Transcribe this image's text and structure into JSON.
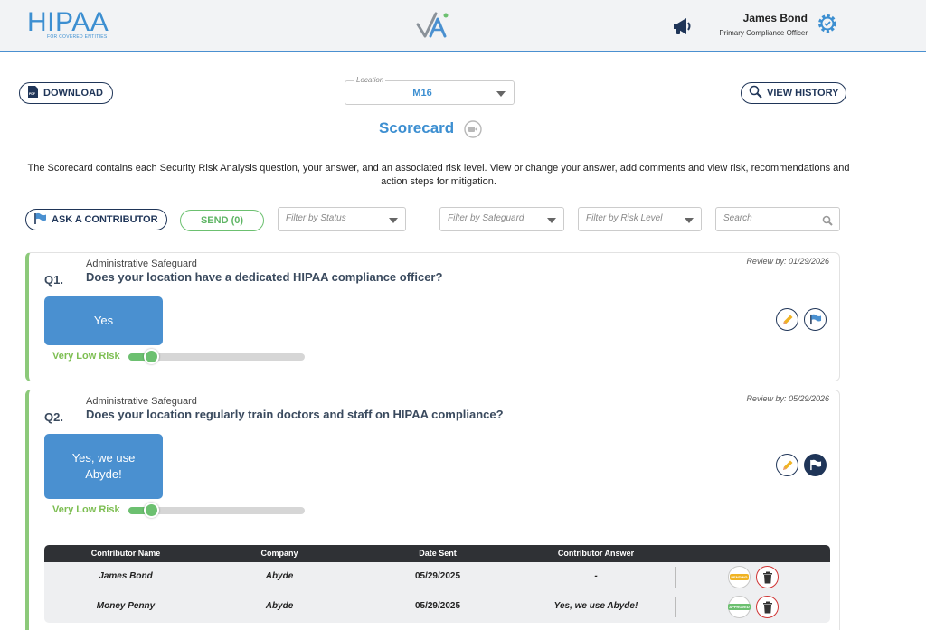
{
  "header": {
    "logo_text": "HIPAA",
    "logo_tagline": "FOR COVERED ENTITIES",
    "user_name": "James Bond",
    "user_role": "Primary Compliance Officer"
  },
  "toolbar": {
    "download_label": "DOWNLOAD",
    "location_label": "Location",
    "location_value": "M16",
    "history_label": "VIEW HISTORY"
  },
  "page": {
    "title": "Scorecard",
    "intro": "The Scorecard contains each Security Risk Analysis question, your answer, and an associated risk level. View or change your answer, add comments and view risk, recommendations and action steps for mitigation."
  },
  "filters": {
    "ask_label": "ASK A CONTRIBUTOR",
    "send_label": "SEND (0)",
    "status_placeholder": "Filter by Status",
    "safeguard_placeholder": "Filter by Safeguard",
    "risk_placeholder": "Filter by Risk Level",
    "search_placeholder": "Search"
  },
  "questions": [
    {
      "number": "Q1.",
      "category": "Administrative Safeguard",
      "text": "Does your location have a dedicated HIPAA compliance officer?",
      "review": "Review by: 01/29/2026",
      "answer": "Yes",
      "risk": "Very Low Risk",
      "risk_level": 0.13
    },
    {
      "number": "Q2.",
      "category": "Administrative Safeguard",
      "text": "Does your location regularly train doctors and staff on HIPAA compliance?",
      "review": "Review by: 05/29/2026",
      "answer": "Yes, we use Abyde!",
      "risk": "Very Low Risk",
      "risk_level": 0.13
    }
  ],
  "contributors": {
    "headers": [
      "Contributor Name",
      "Company",
      "Date Sent",
      "Contributor Answer"
    ],
    "rows": [
      {
        "name": "James Bond",
        "company": "Abyde",
        "date": "05/29/2025",
        "answer": "-",
        "status": "PENDING",
        "status_color": "#f0b323"
      },
      {
        "name": "Money Penny",
        "company": "Abyde",
        "date": "05/29/2025",
        "answer": "Yes, we use Abyde!",
        "status": "APPROVED",
        "status_color": "#6cc070"
      }
    ]
  },
  "colors": {
    "brand_blue": "#3d8fd1",
    "navy": "#1f3558",
    "risk_green": "#6cc070",
    "answer_blue": "#4a90d0"
  }
}
